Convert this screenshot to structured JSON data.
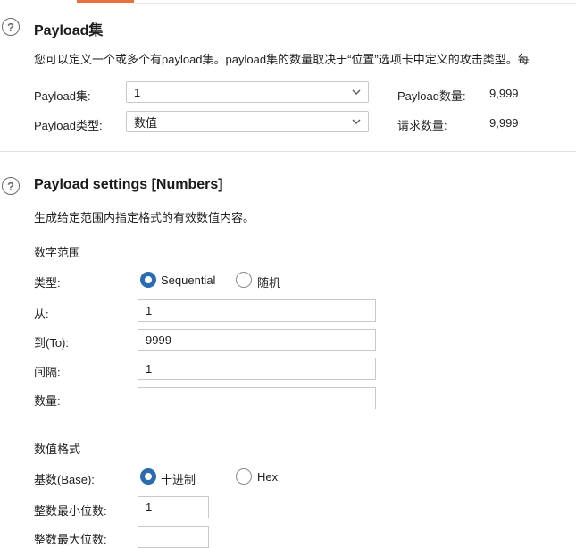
{
  "payload_sets": {
    "title": "Payload集",
    "description": "您可以定义一个或多个有payload集。payload集的数量取决于“位置”选项卡中定义的攻击类型。每",
    "set_label": "Payload集:",
    "set_value": "1",
    "type_label": "Payload类型:",
    "type_value": "数值",
    "count_label": "Payload数量:",
    "count_value": "9,999",
    "request_label": "请求数量:",
    "request_value": "9,999"
  },
  "payload_settings": {
    "title": "Payload settings [Numbers]",
    "description": "生成给定范围内指定格式的有效数值内容。",
    "range_heading": "数字范围",
    "type_label": "类型:",
    "type_options": [
      "Sequential",
      "随机"
    ],
    "type_selected": "Sequential",
    "from_label": "从:",
    "from_value": "1",
    "to_label": "到(To):",
    "to_value": "9999",
    "step_label": "间隔:",
    "step_value": "1",
    "howmany_label": "数量:",
    "howmany_value": "",
    "format_heading": "数值格式",
    "base_label": "基数(Base):",
    "base_options": [
      "十进制",
      "Hex"
    ],
    "base_selected": "十进制",
    "min_int_label": "整数最小位数:",
    "min_int_value": "1",
    "max_int_label": "整数最大位数:",
    "max_int_value": ""
  },
  "colors": {
    "accent": "#e8703a",
    "radio": "#2b6cb0"
  }
}
